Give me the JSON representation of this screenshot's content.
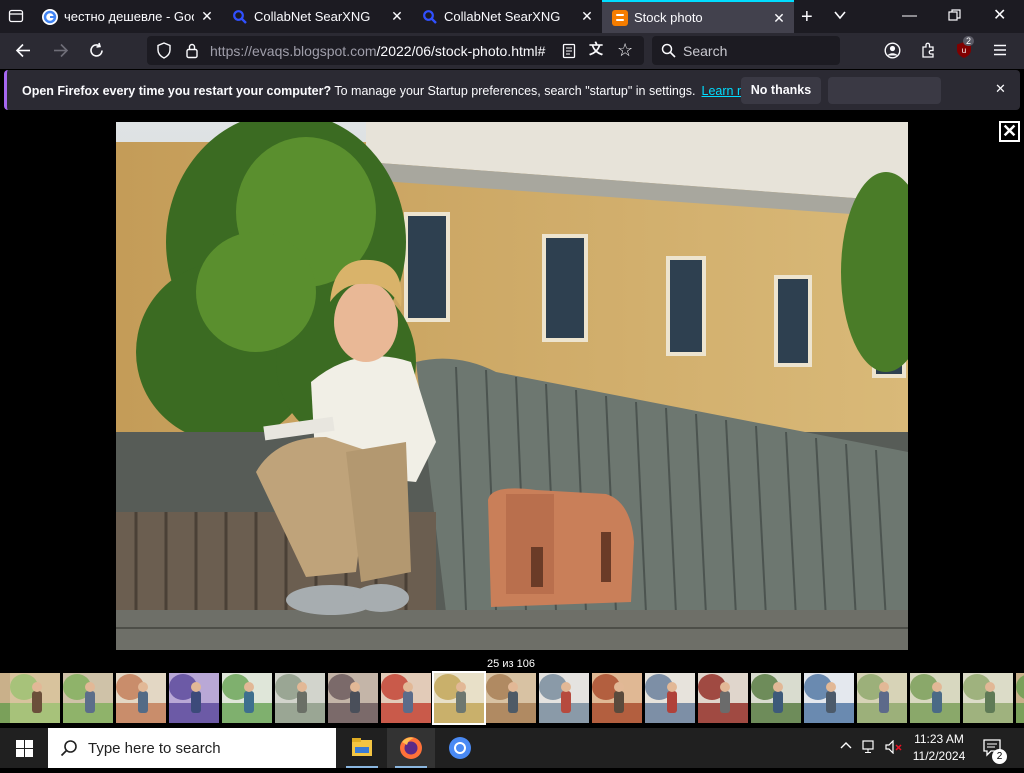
{
  "browser": {
    "tabs": [
      {
        "title": "честно дешевле - Googl",
        "favicon": "google-icon",
        "active": false
      },
      {
        "title": "CollabNet SearXNG",
        "favicon": "search-icon",
        "active": false
      },
      {
        "title": "CollabNet SearXNG",
        "favicon": "search-icon",
        "active": false
      },
      {
        "title": "Stock photo",
        "favicon": "blogger-icon",
        "active": true
      }
    ],
    "url": {
      "host": "https://evaqs.blogspot.com",
      "path": "/2022/06/stock-photo.html#"
    },
    "search_placeholder": "Search",
    "extension_badge": "2"
  },
  "notification": {
    "bold_text": "Open Firefox every time you restart your computer?",
    "text": " To manage your Startup preferences, search \"startup\" in settings.",
    "link": "Learn more",
    "no_thanks": "No thanks"
  },
  "viewer": {
    "counter": "25 из 106",
    "total_thumbs_visible": 20,
    "current_index": 9,
    "close_symbol": "✕"
  },
  "taskbar": {
    "search_placeholder": "Type here to search",
    "time": "11:23 AM",
    "date": "11/2/2024",
    "notification_count": "2"
  },
  "colors": {
    "accent": "#00ddff",
    "notif_border": "#a667f0",
    "taskbar": "#202020"
  }
}
